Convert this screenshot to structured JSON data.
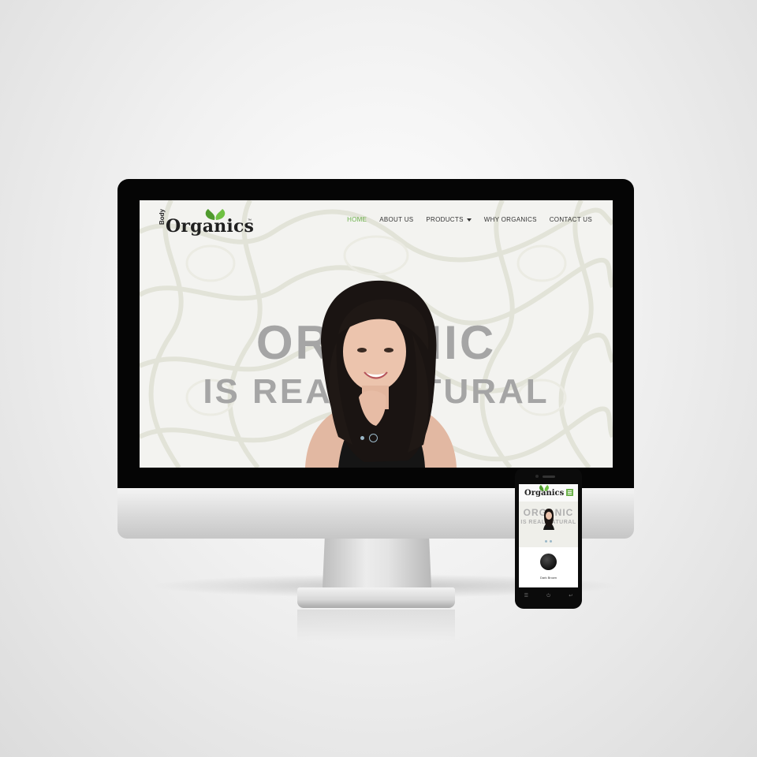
{
  "site": {
    "logo": {
      "prefix": "Body",
      "name": "Organics",
      "trademark": "™"
    },
    "nav": [
      {
        "label": "HOME",
        "active": true
      },
      {
        "label": "ABOUT US"
      },
      {
        "label": "PRODUCTS",
        "dropdown": true
      },
      {
        "label": "WHY ORGANICS"
      },
      {
        "label": "CONTACT US"
      }
    ],
    "hero": {
      "line1": "ORGANIC",
      "line2": "IS REAL NATURAL"
    },
    "carousel_dots": 2
  },
  "mobile": {
    "logo": "Organics",
    "hero": {
      "line1": "ORGANIC",
      "line2": "IS REAL NATURAL"
    },
    "product_caption": "Dark Brown"
  },
  "colors": {
    "accent": "#6db24c",
    "headline": "#a5a5a5",
    "bezel": "#050505"
  },
  "icons": [
    "leaf-icon",
    "caret-down-icon",
    "hamburger-menu-icon",
    "back-icon",
    "home-icon",
    "menu-icon"
  ]
}
